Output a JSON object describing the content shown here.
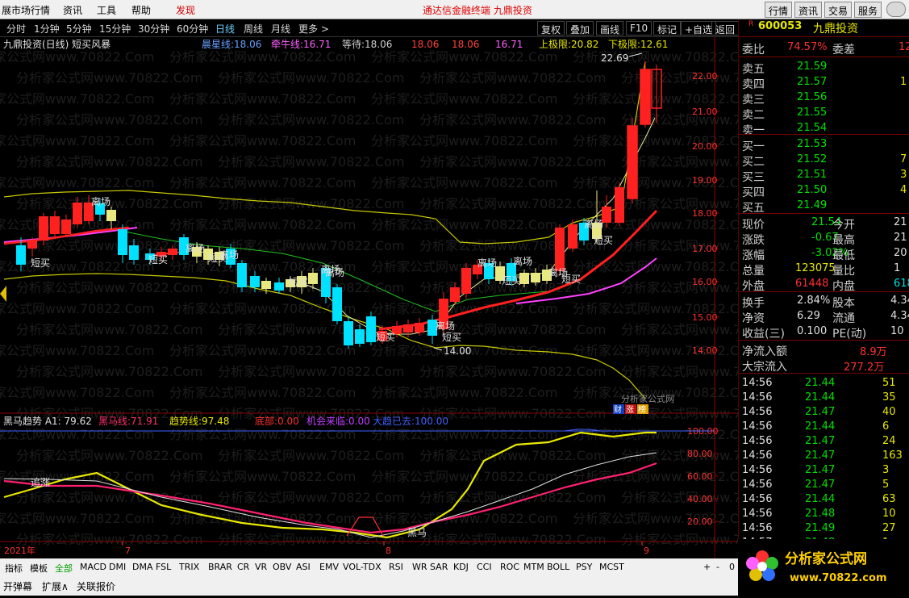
{
  "menu": {
    "items": [
      "展市场行情",
      "资讯",
      "工具",
      "帮助",
      "发现"
    ],
    "center_title": "通达信金融终端   九鼎投资",
    "right_buttons": [
      "行情",
      "资讯",
      "交易",
      "服务"
    ]
  },
  "periods": {
    "tabs": [
      "分时",
      "1分钟",
      "5分钟",
      "15分钟",
      "30分钟",
      "60分钟",
      "日线",
      "周线",
      "月线",
      "更多 >"
    ],
    "active": "日线",
    "tools": [
      "复权",
      "叠加",
      "画线",
      "F10",
      "标记",
      "+自选",
      "返回"
    ]
  },
  "main_chart": {
    "title": "九鼎投资(日线) 短买风暴",
    "indicators": [
      {
        "name": "晨星线:",
        "value": "18.06",
        "color": "#6aa0ff"
      },
      {
        "name": "牵牛线:",
        "value": "16.71",
        "color": "#ff60ff"
      },
      {
        "name": "等待:",
        "value": "18.06",
        "color": "#d0d0d0"
      },
      {
        "name": "",
        "value": "18.06",
        "color": "#ff4040"
      },
      {
        "name": "",
        "value": "18.06",
        "color": "#ff4040"
      },
      {
        "name": "",
        "value": "16.71",
        "color": "#ff60ff"
      },
      {
        "name": "上极限:",
        "value": "20.82",
        "color": "#e8e800"
      },
      {
        "name": "下极限:",
        "value": "12.61",
        "color": "#e8e800"
      }
    ],
    "y_ticks": [
      "22.00",
      "21.00",
      "20.00",
      "19.00",
      "18.00",
      "17.00",
      "16.00",
      "15.00",
      "14.00"
    ],
    "high_label": "22.69",
    "low_label": "14.00",
    "labels": {
      "lichang": "离场",
      "duanmai": "短买"
    },
    "watermark_text": "分析家公式网www.70822.Com",
    "corner_text": "分析家公式网",
    "badges": [
      "财",
      "涨",
      "榜"
    ]
  },
  "sub_chart": {
    "indicators": [
      {
        "name": "黑马趋势",
        "value": "A1: 79.62",
        "color": "#e0e0e0"
      },
      {
        "name": "黑马线:",
        "value": "71.91",
        "color": "#ff3070"
      },
      {
        "name": "趋势线:",
        "value": "97.48",
        "color": "#e8e800"
      },
      {
        "name": "底部:",
        "value": "0.00",
        "color": "#ff3030"
      },
      {
        "name": "机会来临:",
        "value": "0.00",
        "color": "#c040ff"
      },
      {
        "name": "大趋已去:",
        "value": "100.00",
        "color": "#4060ff"
      }
    ],
    "y_ticks": [
      "100.00",
      "80.00",
      "60.00",
      "40.00",
      "20.00"
    ],
    "labels": {
      "zhuizhang": "追涨",
      "heima": "黑马"
    },
    "x_labels": [
      "2021年",
      "7",
      "8",
      "9"
    ]
  },
  "quote": {
    "code": "600053",
    "name": "九鼎投资",
    "r_badge": "R",
    "weibi": {
      "label": "委比",
      "value": "74.57%",
      "label2": "委差",
      "value2": "12"
    },
    "sell": [
      {
        "label": "卖五",
        "price": "21.59",
        "vol": ""
      },
      {
        "label": "卖四",
        "price": "21.57",
        "vol": "1"
      },
      {
        "label": "卖三",
        "price": "21.56",
        "vol": ""
      },
      {
        "label": "卖二",
        "price": "21.55",
        "vol": ""
      },
      {
        "label": "卖一",
        "price": "21.54",
        "vol": ""
      }
    ],
    "buy": [
      {
        "label": "买一",
        "price": "21.53",
        "vol": ""
      },
      {
        "label": "买二",
        "price": "21.52",
        "vol": "7"
      },
      {
        "label": "买三",
        "price": "21.51",
        "vol": "3"
      },
      {
        "label": "买四",
        "price": "21.50",
        "vol": "4"
      },
      {
        "label": "买五",
        "price": "21.49",
        "vol": ""
      }
    ],
    "stats": [
      {
        "l1": "现价",
        "v1": "21.54",
        "c1": "grn",
        "l2": "今开",
        "v2": "21"
      },
      {
        "l1": "涨跌",
        "v1": "-0.67",
        "c1": "grn",
        "l2": "最高",
        "v2": "21"
      },
      {
        "l1": "涨幅",
        "v1": "-3.02%",
        "c1": "grn",
        "l2": "最低",
        "v2": "20"
      },
      {
        "l1": "总量",
        "v1": "123075",
        "c1": "ylw",
        "l2": "量比",
        "v2": "1"
      },
      {
        "l1": "外盘",
        "v1": "61448",
        "c1": "red",
        "l2": "内盘",
        "v2": "618"
      }
    ],
    "stats2": [
      {
        "l1": "换手",
        "v1": "2.84%",
        "l2": "股本",
        "v2": "4.34"
      },
      {
        "l1": "净资",
        "v1": "6.29",
        "l2": "流通",
        "v2": "4.34"
      },
      {
        "l1": "收益(三)",
        "v1": "0.100",
        "l2": "PE(动)",
        "v2": "10"
      }
    ],
    "flow": [
      {
        "label": "净流入额",
        "value": "8.9万"
      },
      {
        "label": "大宗流入",
        "value": "277.2万"
      }
    ],
    "ticks": [
      {
        "t": "14:56",
        "p": "21.44",
        "v": "51"
      },
      {
        "t": "14:56",
        "p": "21.44",
        "v": "35"
      },
      {
        "t": "14:56",
        "p": "21.47",
        "v": "40"
      },
      {
        "t": "14:56",
        "p": "21.44",
        "v": "6"
      },
      {
        "t": "14:56",
        "p": "21.47",
        "v": "24"
      },
      {
        "t": "14:56",
        "p": "21.47",
        "v": "163"
      },
      {
        "t": "14:56",
        "p": "21.47",
        "v": "3"
      },
      {
        "t": "14:56",
        "p": "21.47",
        "v": "5"
      },
      {
        "t": "14:56",
        "p": "21.44",
        "v": "63"
      },
      {
        "t": "14:56",
        "p": "21.48",
        "v": "10"
      },
      {
        "t": "14:56",
        "p": "21.49",
        "v": "27"
      },
      {
        "t": "14:57",
        "p": "21.48",
        "v": "1"
      }
    ]
  },
  "bottom": {
    "tabs": [
      "指标",
      "模板",
      "全部",
      "MACD",
      "DMI",
      "DMA",
      "FSL",
      "TRIX",
      "BRAR",
      "CR",
      "VR",
      "OBV",
      "ASI",
      "EMV",
      "VOL-TDX",
      "RSI",
      "WR",
      "SAR",
      "KDJ",
      "CCI",
      "ROC",
      "MTM",
      "BOLL",
      "PSY",
      "MCST"
    ],
    "active": "全部",
    "row2": [
      "开弹幕",
      "扩展∧",
      "关联报价"
    ],
    "period_label": "日线",
    "controls": [
      "+",
      "-",
      "0"
    ]
  },
  "logo": {
    "text": "分析家公式网",
    "url": "www.70822.com"
  }
}
